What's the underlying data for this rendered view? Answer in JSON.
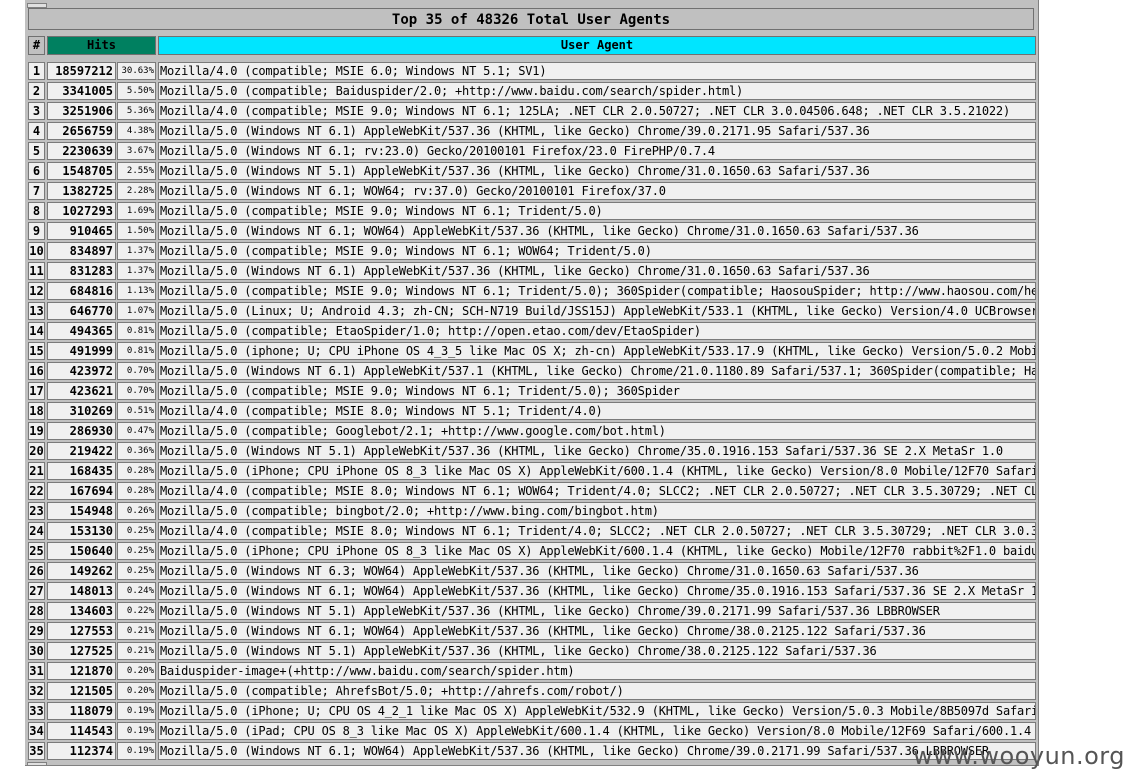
{
  "title": "Top 35 of 48326 Total User Agents",
  "headers": {
    "num": "#",
    "hits": "Hits",
    "ua": "User Agent"
  },
  "colors": {
    "hits_header": "#008060",
    "ua_header": "#00e5ff",
    "cell_bg": "#f0f0f0",
    "frame_bg": "#c0c0c0"
  },
  "watermark": "www.wooyun.org",
  "rows": [
    {
      "num": "1",
      "hits": "18597212",
      "pct": "30.63%",
      "ua": "Mozilla/4.0 (compatible; MSIE 6.0; Windows NT 5.1; SV1)"
    },
    {
      "num": "2",
      "hits": "3341005",
      "pct": "5.50%",
      "ua": "Mozilla/5.0 (compatible; Baiduspider/2.0; +http://www.baidu.com/search/spider.html)"
    },
    {
      "num": "3",
      "hits": "3251906",
      "pct": "5.36%",
      "ua": "Mozilla/4.0 (compatible; MSIE 9.0; Windows NT 6.1; 125LA; .NET CLR 2.0.50727; .NET CLR 3.0.04506.648; .NET CLR 3.5.21022)"
    },
    {
      "num": "4",
      "hits": "2656759",
      "pct": "4.38%",
      "ua": "Mozilla/5.0 (Windows NT 6.1) AppleWebKit/537.36 (KHTML, like Gecko) Chrome/39.0.2171.95 Safari/537.36"
    },
    {
      "num": "5",
      "hits": "2230639",
      "pct": "3.67%",
      "ua": "Mozilla/5.0 (Windows NT 6.1; rv:23.0) Gecko/20100101 Firefox/23.0 FirePHP/0.7.4"
    },
    {
      "num": "6",
      "hits": "1548705",
      "pct": "2.55%",
      "ua": "Mozilla/5.0 (Windows NT 5.1) AppleWebKit/537.36 (KHTML, like Gecko) Chrome/31.0.1650.63 Safari/537.36"
    },
    {
      "num": "7",
      "hits": "1382725",
      "pct": "2.28%",
      "ua": "Mozilla/5.0 (Windows NT 6.1; WOW64; rv:37.0) Gecko/20100101 Firefox/37.0"
    },
    {
      "num": "8",
      "hits": "1027293",
      "pct": "1.69%",
      "ua": "Mozilla/5.0 (compatible; MSIE 9.0; Windows NT 6.1; Trident/5.0)"
    },
    {
      "num": "9",
      "hits": "910465",
      "pct": "1.50%",
      "ua": "Mozilla/5.0 (Windows NT 6.1; WOW64) AppleWebKit/537.36 (KHTML, like Gecko) Chrome/31.0.1650.63 Safari/537.36"
    },
    {
      "num": "10",
      "hits": "834897",
      "pct": "1.37%",
      "ua": "Mozilla/5.0 (compatible; MSIE 9.0; Windows NT 6.1; WOW64; Trident/5.0)"
    },
    {
      "num": "11",
      "hits": "831283",
      "pct": "1.37%",
      "ua": "Mozilla/5.0 (Windows NT 6.1) AppleWebKit/537.36 (KHTML, like Gecko) Chrome/31.0.1650.63 Safari/537.36"
    },
    {
      "num": "12",
      "hits": "684816",
      "pct": "1.13%",
      "ua": "Mozilla/5.0 (compatible; MSIE 9.0; Windows NT 6.1; Trident/5.0); 360Spider(compatible; HaosouSpider; http://www.haosou.com/he"
    },
    {
      "num": "13",
      "hits": "646770",
      "pct": "1.07%",
      "ua": "Mozilla/5.0 (Linux; U; Android 4.3; zh-CN; SCH-N719 Build/JSS15J) AppleWebKit/533.1 (KHTML, like Gecko) Version/4.0 UCBrowser"
    },
    {
      "num": "14",
      "hits": "494365",
      "pct": "0.81%",
      "ua": "Mozilla/5.0 (compatible; EtaoSpider/1.0; http://open.etao.com/dev/EtaoSpider)"
    },
    {
      "num": "15",
      "hits": "491999",
      "pct": "0.81%",
      "ua": "Mozilla/5.0 (iphone; U; CPU iPhone OS 4_3_5 like Mac OS X; zh-cn) AppleWebKit/533.17.9 (KHTML, like Gecko) Version/5.0.2 Mobi"
    },
    {
      "num": "16",
      "hits": "423972",
      "pct": "0.70%",
      "ua": "Mozilla/5.0 (Windows NT 6.1) AppleWebKit/537.1 (KHTML, like Gecko) Chrome/21.0.1180.89 Safari/537.1; 360Spider(compatible; Ha"
    },
    {
      "num": "17",
      "hits": "423621",
      "pct": "0.70%",
      "ua": "Mozilla/5.0 (compatible; MSIE 9.0; Windows NT 6.1; Trident/5.0); 360Spider"
    },
    {
      "num": "18",
      "hits": "310269",
      "pct": "0.51%",
      "ua": "Mozilla/4.0 (compatible; MSIE 8.0; Windows NT 5.1; Trident/4.0)"
    },
    {
      "num": "19",
      "hits": "286930",
      "pct": "0.47%",
      "ua": "Mozilla/5.0 (compatible; Googlebot/2.1; +http://www.google.com/bot.html)"
    },
    {
      "num": "20",
      "hits": "219422",
      "pct": "0.36%",
      "ua": "Mozilla/5.0 (Windows NT 5.1) AppleWebKit/537.36 (KHTML, like Gecko) Chrome/35.0.1916.153 Safari/537.36 SE 2.X MetaSr 1.0"
    },
    {
      "num": "21",
      "hits": "168435",
      "pct": "0.28%",
      "ua": "Mozilla/5.0 (iPhone; CPU iPhone OS 8_3 like Mac OS X) AppleWebKit/600.1.4 (KHTML, like Gecko) Version/8.0 Mobile/12F70 Safari"
    },
    {
      "num": "22",
      "hits": "167694",
      "pct": "0.28%",
      "ua": "Mozilla/4.0 (compatible; MSIE 8.0; Windows NT 6.1; WOW64; Trident/4.0; SLCC2; .NET CLR 2.0.50727; .NET CLR 3.5.30729; .NET CL"
    },
    {
      "num": "23",
      "hits": "154948",
      "pct": "0.26%",
      "ua": "Mozilla/5.0 (compatible; bingbot/2.0; +http://www.bing.com/bingbot.htm)"
    },
    {
      "num": "24",
      "hits": "153130",
      "pct": "0.25%",
      "ua": "Mozilla/4.0 (compatible; MSIE 8.0; Windows NT 6.1; Trident/4.0; SLCC2; .NET CLR 2.0.50727; .NET CLR 3.5.30729; .NET CLR 3.0.3"
    },
    {
      "num": "25",
      "hits": "150640",
      "pct": "0.25%",
      "ua": "Mozilla/5.0 (iPhone; CPU iPhone OS 8_3 like Mac OS X) AppleWebKit/600.1.4 (KHTML, like Gecko) Mobile/12F70 rabbit%2F1.0 baidu"
    },
    {
      "num": "26",
      "hits": "149262",
      "pct": "0.25%",
      "ua": "Mozilla/5.0 (Windows NT 6.3; WOW64) AppleWebKit/537.36 (KHTML, like Gecko) Chrome/31.0.1650.63 Safari/537.36"
    },
    {
      "num": "27",
      "hits": "148013",
      "pct": "0.24%",
      "ua": "Mozilla/5.0 (Windows NT 6.1; WOW64) AppleWebKit/537.36 (KHTML, like Gecko) Chrome/35.0.1916.153 Safari/537.36 SE 2.X MetaSr 1"
    },
    {
      "num": "28",
      "hits": "134603",
      "pct": "0.22%",
      "ua": "Mozilla/5.0 (Windows NT 5.1) AppleWebKit/537.36 (KHTML, like Gecko) Chrome/39.0.2171.99 Safari/537.36 LBBROWSER"
    },
    {
      "num": "29",
      "hits": "127553",
      "pct": "0.21%",
      "ua": "Mozilla/5.0 (Windows NT 6.1; WOW64) AppleWebKit/537.36 (KHTML, like Gecko) Chrome/38.0.2125.122 Safari/537.36"
    },
    {
      "num": "30",
      "hits": "127525",
      "pct": "0.21%",
      "ua": "Mozilla/5.0 (Windows NT 5.1) AppleWebKit/537.36 (KHTML, like Gecko) Chrome/38.0.2125.122 Safari/537.36"
    },
    {
      "num": "31",
      "hits": "121870",
      "pct": "0.20%",
      "ua": "Baiduspider-image+(+http://www.baidu.com/search/spider.htm)"
    },
    {
      "num": "32",
      "hits": "121505",
      "pct": "0.20%",
      "ua": "Mozilla/5.0 (compatible; AhrefsBot/5.0; +http://ahrefs.com/robot/)"
    },
    {
      "num": "33",
      "hits": "118079",
      "pct": "0.19%",
      "ua": "Mozilla/5.0 (iPhone; U; CPU OS 4_2_1 like Mac OS X) AppleWebKit/532.9 (KHTML, like Gecko) Version/5.0.3 Mobile/8B5097d Safari"
    },
    {
      "num": "34",
      "hits": "114543",
      "pct": "0.19%",
      "ua": "Mozilla/5.0 (iPad; CPU OS 8_3 like Mac OS X) AppleWebKit/600.1.4 (KHTML, like Gecko) Version/8.0 Mobile/12F69 Safari/600.1.4"
    },
    {
      "num": "35",
      "hits": "112374",
      "pct": "0.19%",
      "ua": "Mozilla/5.0 (Windows NT 6.1; WOW64) AppleWebKit/537.36 (KHTML, like Gecko) Chrome/39.0.2171.99 Safari/537.36 LBBROWSER"
    }
  ]
}
